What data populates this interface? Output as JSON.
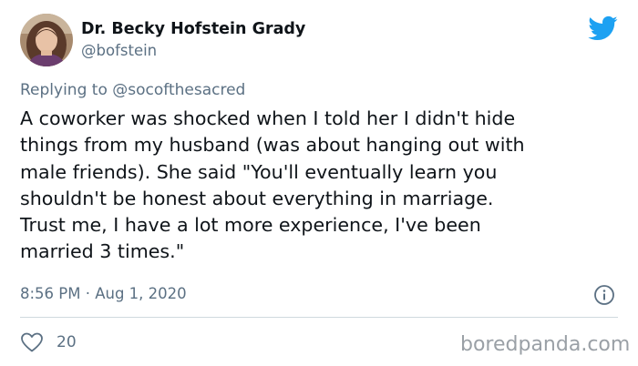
{
  "author": {
    "display_name": "Dr. Becky Hofstein Grady",
    "handle": "@bofstein"
  },
  "reply": {
    "prefix": "Replying to",
    "mention": "@socofthesacred"
  },
  "tweet": {
    "text": "A coworker was shocked when I told her I didn't hide\nthings from my husband (was about hanging out with\nmale friends). She said \"You'll eventually learn you\nshouldn't be honest about everything in marriage.\nTrust me, I have a lot more experience, I've been\nmarried 3 times.\"",
    "timestamp": "8:56 PM · Aug 1, 2020"
  },
  "engagement": {
    "likes": "20"
  },
  "watermark": "boredpanda.com",
  "icons": {
    "brand": "twitter-bird-icon",
    "info": "info-icon",
    "like": "heart-icon"
  },
  "colors": {
    "brand_blue": "#1da1f2",
    "secondary_text": "#5b7083",
    "primary_text": "#0f1419",
    "divider": "#cfd9de",
    "watermark": "#9aa0a6"
  }
}
